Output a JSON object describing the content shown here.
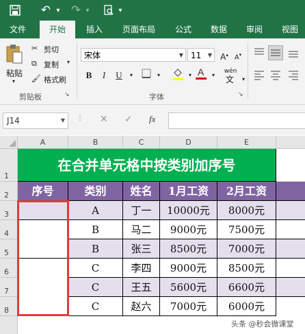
{
  "qat": {
    "save_icon": "save-icon",
    "undo_icon": "undo-icon",
    "redo_icon": "redo-icon",
    "preview_icon": "print-preview-icon",
    "dropdown": "▾"
  },
  "tabs": [
    "文件",
    "开始",
    "插入",
    "页面布局",
    "公式",
    "数据",
    "审阅",
    "视图"
  ],
  "active_tab": "开始",
  "clipboard": {
    "paste": "粘贴",
    "cut": "剪切",
    "copy": "复制",
    "format_painter": "格式刷",
    "group": "剪贴板"
  },
  "font": {
    "name": "宋体",
    "size": "11",
    "bold": "B",
    "italic": "I",
    "underline": "U",
    "group": "字体",
    "phonetic": "wén"
  },
  "formula_bar": {
    "name_box": "J14",
    "fx": "fx",
    "cancel": "✕",
    "enter": "✓",
    "value": ""
  },
  "columns": [
    "A",
    "B",
    "C",
    "D",
    "E"
  ],
  "rows": [
    "1",
    "2",
    "3",
    "4",
    "5",
    "6",
    "7",
    "8"
  ],
  "title": "在合并单元格中按类别加序号",
  "headers": [
    "序号",
    "类别",
    "姓名",
    "1月工资",
    "2月工资"
  ],
  "data_rows": [
    [
      "A",
      "丁一",
      "10000元",
      "8000元"
    ],
    [
      "B",
      "马二",
      "9000元",
      "7500元"
    ],
    [
      "B",
      "张三",
      "8500元",
      "7000元"
    ],
    [
      "C",
      "李四",
      "9000元",
      "8500元"
    ],
    [
      "C",
      "王五",
      "5600元",
      "6600元"
    ],
    [
      "C",
      "赵六",
      "7000元",
      "6000元"
    ]
  ],
  "colors": {
    "excel_green": "#217346",
    "title_green": "#00b050",
    "header_purple": "#8064a2",
    "band_lavender": "#e4dfec",
    "selection_red": "#e03a3a"
  },
  "watermark": "头条 @秒会微课堂"
}
